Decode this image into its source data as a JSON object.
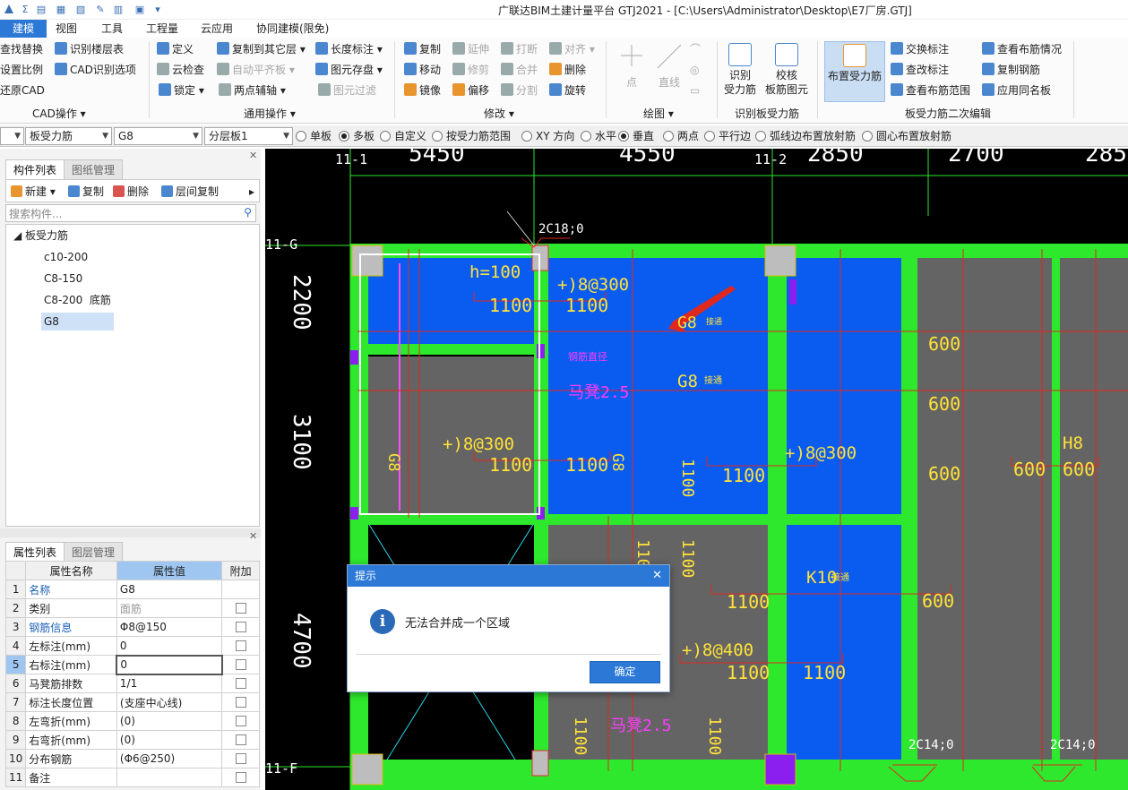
{
  "window_title": "广联达BIM土建计量平台 GTJ2021 - [C:\\Users\\Administrator\\Desktop\\E7厂房.GTJ]",
  "quick_access": [
    "Σ",
    "▤",
    "▦",
    "▧",
    "✎",
    "▥",
    "▣",
    "▾"
  ],
  "menu_tabs": [
    "建模",
    "视图",
    "工具",
    "工程量",
    "云应用",
    "协同建模(限免)"
  ],
  "ribbon": {
    "cad": {
      "items": [
        "查找替换",
        "识别楼层表",
        "设置比例",
        "CAD识别选项",
        "还原CAD"
      ],
      "label": "CAD操作"
    },
    "general": {
      "items": [
        "定义",
        "复制到其它层",
        "长度标注",
        "云检查",
        "自动平齐板",
        "图元存盘",
        "锁定",
        "两点辅轴",
        "图元过滤"
      ],
      "label": "通用操作"
    },
    "modify": {
      "items": [
        "复制",
        "延伸",
        "打断",
        "对齐",
        "移动",
        "修剪",
        "合并",
        "删除",
        "镜像",
        "偏移",
        "分割",
        "旋转"
      ],
      "label": "修改"
    },
    "draw": {
      "items": [
        "点",
        "直线"
      ],
      "label": "绘图"
    },
    "recognize": {
      "items": [
        "识别\n受力筋",
        "校核\n板筋图元"
      ],
      "label": "识别板受力筋"
    },
    "edit2": {
      "big": "布置受力筋",
      "items": [
        "交换标注",
        "查看布筋情况",
        "查改标注",
        "复制钢筋",
        "查看布筋范围",
        "应用同名板"
      ],
      "label": "板受力筋二次编辑"
    }
  },
  "toolbar2": {
    "combos": [
      "",
      "板受力筋",
      "G8",
      "分层板1"
    ],
    "radios": [
      "单板",
      "多板",
      "自定义",
      "按受力筋范围",
      "XY 方向",
      "水平",
      "垂直",
      "两点",
      "平行边",
      "弧线边布置放射筋",
      "圆心布置放射筋"
    ],
    "checked": [
      "多板",
      "垂直"
    ]
  },
  "component_panel": {
    "tabs": [
      "构件列表",
      "图纸管理"
    ],
    "tools": [
      "新建",
      "复制",
      "删除",
      "层间复制"
    ],
    "search_placeholder": "搜索构件...",
    "tree_root": "板受力筋",
    "tree_items": [
      "c10-200",
      "C8-150",
      "C8-200  底筋",
      "G8"
    ],
    "selected": "G8"
  },
  "property_panel": {
    "tabs": [
      "属性列表",
      "图层管理"
    ],
    "headers": [
      "",
      "属性名称",
      "属性值",
      "附加"
    ],
    "rows": [
      {
        "n": "1",
        "name": "名称",
        "value": "G8"
      },
      {
        "n": "2",
        "name": "类别",
        "value": "面筋"
      },
      {
        "n": "3",
        "name": "钢筋信息",
        "value": "Φ8@150"
      },
      {
        "n": "4",
        "name": "左标注(mm)",
        "value": "0"
      },
      {
        "n": "5",
        "name": "右标注(mm)",
        "value": "0"
      },
      {
        "n": "6",
        "name": "马凳筋排数",
        "value": "1/1"
      },
      {
        "n": "7",
        "name": "标注长度位置",
        "value": "(支座中心线)"
      },
      {
        "n": "8",
        "name": "左弯折(mm)",
        "value": "(0)"
      },
      {
        "n": "9",
        "name": "右弯折(mm)",
        "value": "(0)"
      },
      {
        "n": "10",
        "name": "分布钢筋",
        "value": "(Φ6@250)"
      },
      {
        "n": "11",
        "name": "备注",
        "value": ""
      }
    ]
  },
  "canvas": {
    "axis_labels": [
      "11-1",
      "11-2",
      "11-G",
      "11-F"
    ],
    "dims_top": [
      "5450",
      "4550",
      "2850",
      "2700",
      "285"
    ],
    "dims_left": [
      "2200",
      "3100",
      "4700"
    ],
    "rebar_tags": [
      "2C18;0",
      "2C14;0",
      "2C14;0"
    ],
    "texts": {
      "h100": "h=100",
      "r1": "+)8@300",
      "r2": "+)8@300",
      "r3": "+)8@300",
      "r4": "+)8@400",
      "g8": "G8",
      "k10": "K10",
      "h8": "H8",
      "tag": "接通",
      "magenta1": "钢筋直径",
      "magenta2": "马凳2.5",
      "v600": "600",
      "v1100": "1100"
    }
  },
  "dialog": {
    "title": "提示",
    "message": "无法合并成一个区域",
    "ok": "确定"
  },
  "colors": {
    "accent": "#2b78d6",
    "slab_blue": "#0a5cf0",
    "beam_green": "#2ee82e",
    "slab_gray": "#646464",
    "rebar_red": "#e0281e",
    "dim_yellow": "#ffe23a"
  }
}
